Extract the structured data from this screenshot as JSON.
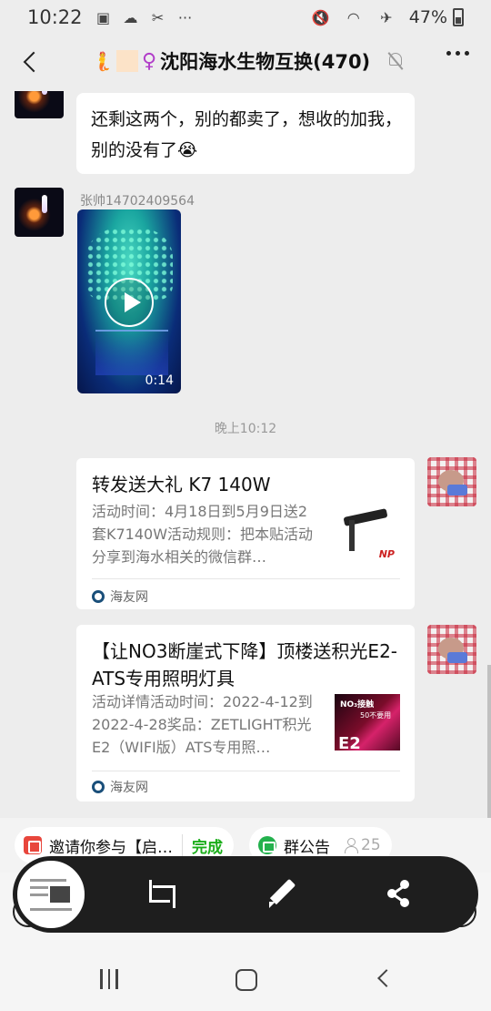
{
  "status_bar": {
    "time": "10:22",
    "battery": "47%"
  },
  "header": {
    "title_emoji": "🧜",
    "title_gender": "♀",
    "title": "沈阳海水生物互换(470)"
  },
  "messages": {
    "text_message": "还剩这两个，别的都卖了，想收的加我，别的没有了😭",
    "video_sender": "张帅14702409564",
    "video_duration": "0:14",
    "timestamp": "晚上10:12",
    "cards": [
      {
        "title": "转发送大礼 K7 140W",
        "description": "活动时间：4月18日到5月9日送2套K7140W活动规则：把本贴活动分享到海水相关的微信群…",
        "source": "海友网",
        "thumb_logo": "NP"
      },
      {
        "title": "【让NO3断崖式下降】顶楼送积光E2-ATS专用照明灯具",
        "description": "活动详情活动时间：2022-4-12到2022-4-28奖品：ZETLIGHT积光E2（WIFI版）ATS专用照…",
        "source": "海友网",
        "thumb_line1": "NO₃接触",
        "thumb_line2": "50不要用",
        "thumb_badge": "E2"
      }
    ]
  },
  "chips": {
    "invite_text": "邀请你参与【启…",
    "invite_action": "完成",
    "notice_label": "群公告",
    "notice_count": "25"
  },
  "colors": {
    "accent_green": "#1aad19",
    "chat_bg": "#ededed",
    "toolbar_bg": "#1e1e1e"
  }
}
